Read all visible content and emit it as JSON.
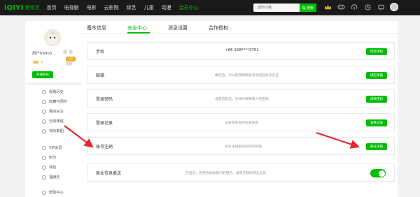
{
  "topbar": {
    "logo_text": "iQIYI",
    "logo_cn": "爱奇艺",
    "nav": [
      "首页",
      "电视剧",
      "电影",
      "云影院",
      "综艺",
      "儿童",
      "动漫",
      "会员中心"
    ],
    "active_nav": "会员中心",
    "search_placeholder": "迷你小路",
    "search_button": "搜索"
  },
  "profile": {
    "name": "用户669b0...",
    "tag": "VIP",
    "sign": "签到",
    "open_vip": "开通会员"
  },
  "sidebar": {
    "items": [
      {
        "label": "观看历史",
        "icon": "clock-icon"
      },
      {
        "label": "收藏与预约",
        "icon": "star-icon"
      },
      {
        "label": "我的关注",
        "icon": "heart-icon"
      },
      {
        "label": "已购课程",
        "icon": "cart-icon"
      },
      {
        "label": "我的截图",
        "icon": "image-icon"
      },
      {
        "label": "VIP会员",
        "icon": "vip-icon"
      },
      {
        "label": "积分",
        "icon": "coin-icon"
      },
      {
        "label": "钱包",
        "icon": "wallet-icon"
      },
      {
        "label": "福服务",
        "icon": "gift-icon"
      },
      {
        "label": "帮助中心",
        "icon": "help-icon"
      }
    ]
  },
  "tabs": [
    "基本信息",
    "安全中心",
    "消息设置",
    "合作授权"
  ],
  "active_tab": "安全中心",
  "rows": [
    {
      "label": "手机",
      "value": "+86 158****3701",
      "button": "修改手机"
    },
    {
      "label": "邮箱",
      "desc": "绑定后，可以使用邮箱登录或找回账号安全",
      "button": "绑定邮箱"
    },
    {
      "label": "登录密码",
      "desc": "设置密码后，登录时需要输入的密码",
      "button": "修改密码"
    },
    {
      "label": "登录记录",
      "desc": "记录您账号的登录情况",
      "button": "查看记录"
    },
    {
      "label": "账号注销",
      "desc": "账号注销相关的操作管理",
      "button": "账号注销"
    },
    {
      "label": "商业信息推送",
      "desc": "开启后，您将会接收我们的服务、爱奇艺精彩商业信息",
      "toggle_on": true
    }
  ],
  "colors": {
    "accent": "#00be06",
    "arrow": "#e8262e",
    "topbar": "#1a1a1a"
  }
}
